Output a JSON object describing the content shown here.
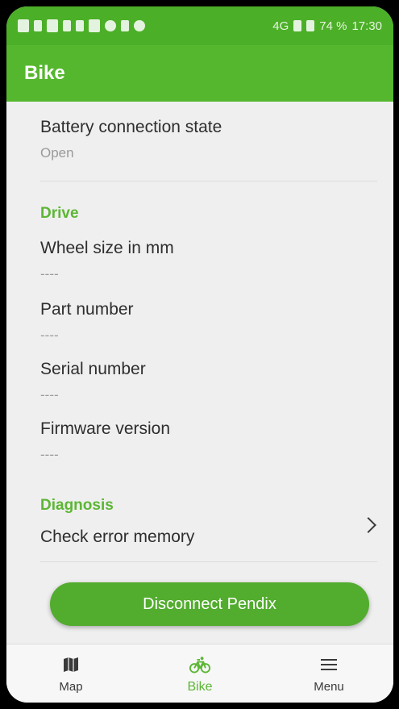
{
  "status_bar": {
    "network": "4G",
    "battery": "74 %",
    "time": "17:30"
  },
  "app_bar": {
    "title": "Bike"
  },
  "battery_item": {
    "title": "Battery connection state",
    "value": "Open"
  },
  "drive": {
    "header": "Drive",
    "items": [
      {
        "title": "Wheel size in mm",
        "value": "----"
      },
      {
        "title": "Part number",
        "value": "----"
      },
      {
        "title": "Serial number",
        "value": "----"
      },
      {
        "title": "Firmware version",
        "value": "----"
      }
    ]
  },
  "diagnosis": {
    "header": "Diagnosis",
    "item": "Check error memory"
  },
  "actions": {
    "disconnect_label": "Disconnect Pendix"
  },
  "bottom_nav": {
    "items": [
      {
        "label": "Map",
        "icon": "map-icon"
      },
      {
        "label": "Bike",
        "icon": "bike-icon",
        "active": true
      },
      {
        "label": "Menu",
        "icon": "menu-icon"
      }
    ]
  },
  "colors": {
    "primary": "#55b72e",
    "accent_text": "#5cb634"
  }
}
